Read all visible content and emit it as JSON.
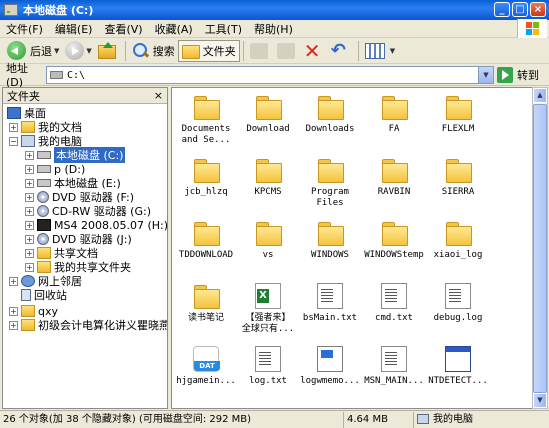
{
  "window": {
    "title": "本地磁盘 (C:)"
  },
  "menu": [
    "文件(F)",
    "编辑(E)",
    "查看(V)",
    "收藏(A)",
    "工具(T)",
    "帮助(H)"
  ],
  "toolbar": {
    "back": "后退",
    "search": "搜索",
    "folders": "文件夹"
  },
  "address": {
    "label": "地址(D)",
    "path": "C:\\",
    "go": "转到"
  },
  "folder_pane": {
    "title": "文件夹",
    "close": "×",
    "tree": [
      {
        "label": "桌面",
        "icon": "desktop-icon"
      },
      {
        "label": "我的文档",
        "icon": "documents-icon"
      },
      {
        "label": "我的电脑",
        "icon": "computer-icon"
      },
      {
        "label": "本地磁盘 (C:)",
        "icon": "drive-icon",
        "selected": true
      },
      {
        "label": "p (D:)",
        "icon": "drive-icon"
      },
      {
        "label": "本地磁盘 (E:)",
        "icon": "drive-icon"
      },
      {
        "label": "DVD 驱动器 (F:)",
        "icon": "dvd-icon"
      },
      {
        "label": "CD-RW 驱动器 (G:)",
        "icon": "cd-icon"
      },
      {
        "label": "MS4 2008.05.07 (H:)",
        "icon": "sd-card-icon"
      },
      {
        "label": "DVD 驱动器 (J:)",
        "icon": "dvd-icon"
      },
      {
        "label": "共享文档",
        "icon": "shared-folder-icon"
      },
      {
        "label": "我的共享文件夹",
        "icon": "shared-folder-icon"
      },
      {
        "label": "网上邻居",
        "icon": "network-icon"
      },
      {
        "label": "回收站",
        "icon": "recycle-bin-icon"
      },
      {
        "label": "qxy",
        "icon": "folder-icon"
      },
      {
        "label": "初级会计电算化讲义瞿晓燕",
        "icon": "folder-icon"
      }
    ]
  },
  "files": [
    {
      "name": "Documents\nand Se...",
      "type": "folder"
    },
    {
      "name": "Download",
      "type": "folder"
    },
    {
      "name": "Downloads",
      "type": "folder"
    },
    {
      "name": "FA",
      "type": "folder"
    },
    {
      "name": "FLEXLM",
      "type": "folder"
    },
    {
      "name": "jcb_hlzq",
      "type": "folder"
    },
    {
      "name": "KPCMS",
      "type": "folder"
    },
    {
      "name": "Program\nFiles",
      "type": "folder"
    },
    {
      "name": "RAVBIN",
      "type": "folder"
    },
    {
      "name": "SIERRA",
      "type": "folder"
    },
    {
      "name": "TDDOWNLOAD",
      "type": "folder"
    },
    {
      "name": "vs",
      "type": "folder"
    },
    {
      "name": "WINDOWS",
      "type": "folder"
    },
    {
      "name": "WINDOWStemp",
      "type": "folder"
    },
    {
      "name": "xiaoi_log",
      "type": "folder"
    },
    {
      "name": "读书笔记",
      "type": "folder"
    },
    {
      "name": "【强者来】\n全球只有...",
      "type": "excel"
    },
    {
      "name": "bsMain.txt",
      "type": "text"
    },
    {
      "name": "cmd.txt",
      "type": "text"
    },
    {
      "name": "debug.log",
      "type": "text"
    },
    {
      "name": "hjgamein...",
      "type": "dat"
    },
    {
      "name": "log.txt",
      "type": "text"
    },
    {
      "name": "logwmemo...",
      "type": "memo"
    },
    {
      "name": "MSN_MAIN...",
      "type": "text"
    },
    {
      "name": "NTDETECT...",
      "type": "sys"
    }
  ],
  "status": {
    "objects": "26 个对象(加 38 个隐藏对象) (可用磁盘空间: 292 MB)",
    "size": "4.64 MB",
    "location": "我的电脑"
  }
}
